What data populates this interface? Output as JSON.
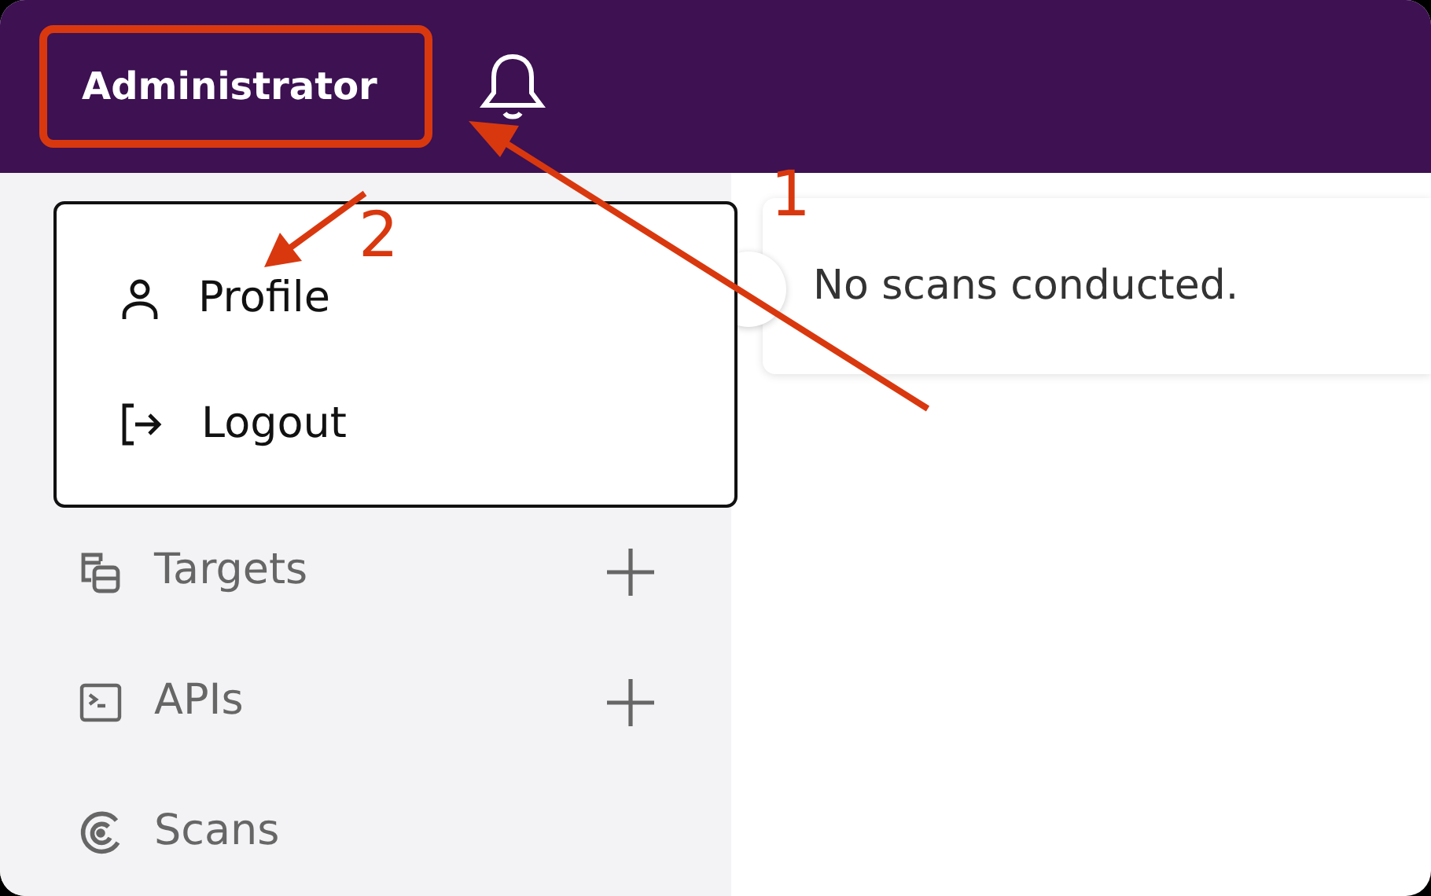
{
  "header": {
    "user": "Administrator"
  },
  "user_menu": {
    "items": [
      {
        "kind": "profile",
        "label": "Profile"
      },
      {
        "kind": "logout",
        "label": "Logout"
      }
    ]
  },
  "sidebar": {
    "items": [
      {
        "kind": "targets",
        "label": "Targets",
        "addable": true
      },
      {
        "kind": "apis",
        "label": "APIs",
        "addable": true
      },
      {
        "kind": "scans",
        "label": "Scans",
        "addable": false
      }
    ]
  },
  "main": {
    "message": "No scans conducted."
  },
  "annotations": [
    {
      "label": "1"
    },
    {
      "label": "2"
    }
  ]
}
